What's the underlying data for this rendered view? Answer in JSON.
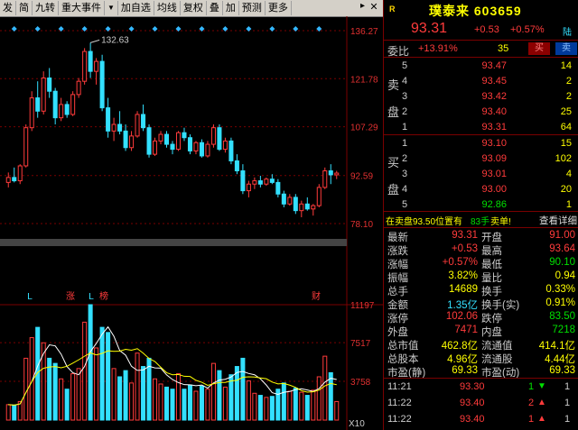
{
  "toolbar": {
    "items": [
      "发",
      "简",
      "九转",
      "重大事件",
      "▼",
      "加自选",
      "均线",
      "复权",
      "叠",
      "加",
      "预测",
      "更多"
    ],
    "close": "✕"
  },
  "chart_data": {
    "type": "candlestick",
    "price_axis_labels": [
      "136.27",
      "121.78",
      "107.29",
      "92.59",
      "78.10"
    ],
    "price_ylim": [
      78.1,
      136.27
    ],
    "max_label": "132.63",
    "volume_axis_labels": [
      "11197",
      "7517",
      "3758"
    ],
    "volume_unit": "X10",
    "markers": [
      {
        "text": "L",
        "color": "#33e0ff"
      },
      {
        "text": "涨",
        "color": "#ff3b3b"
      },
      {
        "text": "L",
        "color": "#33e0ff"
      },
      {
        "text": "榜",
        "color": "#ff3b3b"
      },
      {
        "text": "财",
        "color": "#ff3b3b"
      }
    ],
    "candles": [
      {
        "o": 90.5,
        "h": 93.5,
        "l": 89.0,
        "c": 92.0,
        "v": 1500
      },
      {
        "o": 92.0,
        "h": 95.0,
        "l": 90.5,
        "c": 91.0,
        "v": 1400
      },
      {
        "o": 91.0,
        "h": 96.0,
        "l": 90.0,
        "c": 95.5,
        "v": 1800
      },
      {
        "o": 95.5,
        "h": 108.0,
        "l": 95.0,
        "c": 107.0,
        "v": 6000
      },
      {
        "o": 107.0,
        "h": 118.0,
        "l": 106.0,
        "c": 116.0,
        "v": 8000
      },
      {
        "o": 116.0,
        "h": 121.0,
        "l": 110.0,
        "c": 112.0,
        "v": 9000
      },
      {
        "o": 112.0,
        "h": 124.0,
        "l": 111.0,
        "c": 122.0,
        "v": 7500
      },
      {
        "o": 122.0,
        "h": 125.0,
        "l": 116.0,
        "c": 118.0,
        "v": 6000
      },
      {
        "o": 118.0,
        "h": 119.0,
        "l": 108.0,
        "c": 110.0,
        "v": 5500
      },
      {
        "o": 110.0,
        "h": 116.0,
        "l": 109.0,
        "c": 114.0,
        "v": 4000
      },
      {
        "o": 114.0,
        "h": 115.0,
        "l": 110.0,
        "c": 111.0,
        "v": 3000
      },
      {
        "o": 111.0,
        "h": 118.0,
        "l": 110.5,
        "c": 117.0,
        "v": 4500
      },
      {
        "o": 117.0,
        "h": 122.0,
        "l": 116.0,
        "c": 121.0,
        "v": 5000
      },
      {
        "o": 121.0,
        "h": 131.0,
        "l": 120.0,
        "c": 130.0,
        "v": 9500
      },
      {
        "o": 130.0,
        "h": 132.63,
        "l": 122.0,
        "c": 124.0,
        "v": 11197
      },
      {
        "o": 124.0,
        "h": 128.0,
        "l": 120.0,
        "c": 127.0,
        "v": 7000
      },
      {
        "o": 127.0,
        "h": 129.0,
        "l": 112.0,
        "c": 113.0,
        "v": 9000
      },
      {
        "o": 113.0,
        "h": 116.0,
        "l": 104.0,
        "c": 106.0,
        "v": 8500
      },
      {
        "o": 106.0,
        "h": 110.0,
        "l": 103.0,
        "c": 108.0,
        "v": 5000
      },
      {
        "o": 108.0,
        "h": 112.0,
        "l": 105.0,
        "c": 106.0,
        "v": 4200
      },
      {
        "o": 106.0,
        "h": 108.0,
        "l": 100.0,
        "c": 101.0,
        "v": 4800
      },
      {
        "o": 101.0,
        "h": 106.0,
        "l": 100.0,
        "c": 104.5,
        "v": 3600
      },
      {
        "o": 104.5,
        "h": 112.0,
        "l": 104.0,
        "c": 111.0,
        "v": 6500
      },
      {
        "o": 111.0,
        "h": 114.0,
        "l": 106.0,
        "c": 107.0,
        "v": 5200
      },
      {
        "o": 107.0,
        "h": 108.0,
        "l": 98.0,
        "c": 99.0,
        "v": 6000
      },
      {
        "o": 99.0,
        "h": 104.0,
        "l": 98.5,
        "c": 103.0,
        "v": 4000
      },
      {
        "o": 103.0,
        "h": 106.0,
        "l": 102.0,
        "c": 105.0,
        "v": 3500
      },
      {
        "o": 105.0,
        "h": 106.0,
        "l": 101.0,
        "c": 102.0,
        "v": 3200
      },
      {
        "o": 102.0,
        "h": 103.0,
        "l": 99.0,
        "c": 100.5,
        "v": 3000
      },
      {
        "o": 100.5,
        "h": 106.0,
        "l": 100.0,
        "c": 105.5,
        "v": 4500
      },
      {
        "o": 105.5,
        "h": 107.0,
        "l": 103.0,
        "c": 104.0,
        "v": 3000
      },
      {
        "o": 104.0,
        "h": 105.0,
        "l": 99.0,
        "c": 100.0,
        "v": 3400
      },
      {
        "o": 100.0,
        "h": 103.0,
        "l": 99.0,
        "c": 102.5,
        "v": 2800
      },
      {
        "o": 102.5,
        "h": 103.5,
        "l": 98.0,
        "c": 98.5,
        "v": 3300
      },
      {
        "o": 98.5,
        "h": 103.0,
        "l": 98.0,
        "c": 102.0,
        "v": 3000
      },
      {
        "o": 102.0,
        "h": 108.0,
        "l": 101.0,
        "c": 107.0,
        "v": 5500
      },
      {
        "o": 107.0,
        "h": 108.0,
        "l": 100.0,
        "c": 100.5,
        "v": 4800
      },
      {
        "o": 100.5,
        "h": 104.0,
        "l": 99.5,
        "c": 103.0,
        "v": 3200
      },
      {
        "o": 103.0,
        "h": 104.0,
        "l": 96.0,
        "c": 97.0,
        "v": 4400
      },
      {
        "o": 97.0,
        "h": 99.0,
        "l": 93.0,
        "c": 94.0,
        "v": 5200
      },
      {
        "o": 94.0,
        "h": 96.0,
        "l": 87.0,
        "c": 88.0,
        "v": 6000
      },
      {
        "o": 88.0,
        "h": 91.0,
        "l": 86.0,
        "c": 90.0,
        "v": 3800
      },
      {
        "o": 90.0,
        "h": 92.0,
        "l": 88.5,
        "c": 91.0,
        "v": 2600
      },
      {
        "o": 91.0,
        "h": 92.5,
        "l": 89.0,
        "c": 90.0,
        "v": 2400
      },
      {
        "o": 90.0,
        "h": 92.0,
        "l": 89.5,
        "c": 91.5,
        "v": 2200
      },
      {
        "o": 91.5,
        "h": 93.0,
        "l": 90.0,
        "c": 90.5,
        "v": 2300
      },
      {
        "o": 90.5,
        "h": 91.5,
        "l": 86.0,
        "c": 87.0,
        "v": 3000
      },
      {
        "o": 87.0,
        "h": 88.0,
        "l": 83.0,
        "c": 84.0,
        "v": 3600
      },
      {
        "o": 84.0,
        "h": 87.0,
        "l": 83.5,
        "c": 86.0,
        "v": 2800
      },
      {
        "o": 86.0,
        "h": 87.0,
        "l": 81.0,
        "c": 82.0,
        "v": 3100
      },
      {
        "o": 82.0,
        "h": 85.0,
        "l": 80.0,
        "c": 84.0,
        "v": 2700
      },
      {
        "o": 84.0,
        "h": 86.0,
        "l": 82.0,
        "c": 82.5,
        "v": 2400
      },
      {
        "o": 82.5,
        "h": 84.0,
        "l": 80.5,
        "c": 83.5,
        "v": 2900
      },
      {
        "o": 83.5,
        "h": 90.0,
        "l": 83.0,
        "c": 89.0,
        "v": 4200
      },
      {
        "o": 89.0,
        "h": 95.0,
        "l": 88.5,
        "c": 94.0,
        "v": 6200
      },
      {
        "o": 94.0,
        "h": 96.0,
        "l": 90.0,
        "c": 92.8,
        "v": 4600
      },
      {
        "o": 92.8,
        "h": 94.0,
        "l": 91.5,
        "c": 93.31,
        "v": 1800
      }
    ]
  },
  "panel": {
    "market_tag": "R",
    "name": "璞泰来",
    "code": "603659",
    "price": "93.31",
    "change": "+0.53",
    "change_pct": "+0.57%",
    "flag": "陆",
    "ratio_label": "委比",
    "ratio_value": "+13.91%",
    "ratio_diff": "35",
    "buy_btn": "买",
    "sell_btn": "卖",
    "sell_side_label_1": "卖",
    "sell_side_label_2": "盘",
    "buy_side_label_1": "买",
    "buy_side_label_2": "盘",
    "sells": [
      {
        "lvl": "5",
        "px": "93.47",
        "qty": "14"
      },
      {
        "lvl": "4",
        "px": "93.45",
        "qty": "2"
      },
      {
        "lvl": "3",
        "px": "93.42",
        "qty": "2"
      },
      {
        "lvl": "2",
        "px": "93.40",
        "qty": "25"
      },
      {
        "lvl": "1",
        "px": "93.31",
        "qty": "64"
      }
    ],
    "buys": [
      {
        "lvl": "1",
        "px": "93.10",
        "qty": "15"
      },
      {
        "lvl": "2",
        "px": "93.09",
        "qty": "102"
      },
      {
        "lvl": "3",
        "px": "93.01",
        "qty": "4"
      },
      {
        "lvl": "4",
        "px": "93.00",
        "qty": "20"
      },
      {
        "lvl": "5",
        "px": "92.86",
        "qty": "1"
      }
    ],
    "notice_a": "在卖盘93.50位置有",
    "notice_b": "83手",
    "notice_c": "卖单!",
    "notice_link": "查看详细",
    "stats": [
      {
        "l1": "最新",
        "v1": "93.31",
        "c1": "red",
        "l2": "开盘",
        "v2": "91.00",
        "c2": "red"
      },
      {
        "l1": "涨跌",
        "v1": "+0.53",
        "c1": "red",
        "l2": "最高",
        "v2": "93.64",
        "c2": "red"
      },
      {
        "l1": "涨幅",
        "v1": "+0.57%",
        "c1": "red",
        "l2": "最低",
        "v2": "90.10",
        "c2": "grn"
      },
      {
        "l1": "振幅",
        "v1": "3.82%",
        "c1": "yel",
        "l2": "量比",
        "v2": "0.94",
        "c2": "yel"
      },
      {
        "l1": "总手",
        "v1": "14689",
        "c1": "yel",
        "l2": "换手",
        "v2": "0.33%",
        "c2": "yel"
      },
      {
        "l1": "金额",
        "v1": "1.35亿",
        "c1": "cy",
        "l2": "换手(实)",
        "v2": "0.91%",
        "c2": "yel"
      },
      {
        "l1": "涨停",
        "v1": "102.06",
        "c1": "red",
        "l2": "跌停",
        "v2": "83.50",
        "c2": "grn"
      },
      {
        "l1": "外盘",
        "v1": "7471",
        "c1": "red",
        "l2": "内盘",
        "v2": "7218",
        "c2": "grn"
      },
      {
        "l1": "总市值",
        "v1": "462.8亿",
        "c1": "yel",
        "l2": "流通值",
        "v2": "414.1亿",
        "c2": "yel"
      },
      {
        "l1": "总股本",
        "v1": "4.96亿",
        "c1": "yel",
        "l2": "流通股",
        "v2": "4.44亿",
        "c2": "yel"
      },
      {
        "l1": "市盈(静)",
        "v1": "69.33",
        "c1": "yel",
        "l2": "市盈(动)",
        "v2": "69.33",
        "c2": "yel"
      }
    ],
    "ticks": [
      {
        "time": "11:21",
        "px": "93.30",
        "vol": "1",
        "dir": "down",
        "cnt": "1"
      },
      {
        "time": "11:22",
        "px": "93.40",
        "vol": "2",
        "dir": "up",
        "cnt": "1"
      },
      {
        "time": "11:22",
        "px": "93.40",
        "vol": "1",
        "dir": "up",
        "cnt": "1"
      }
    ]
  }
}
